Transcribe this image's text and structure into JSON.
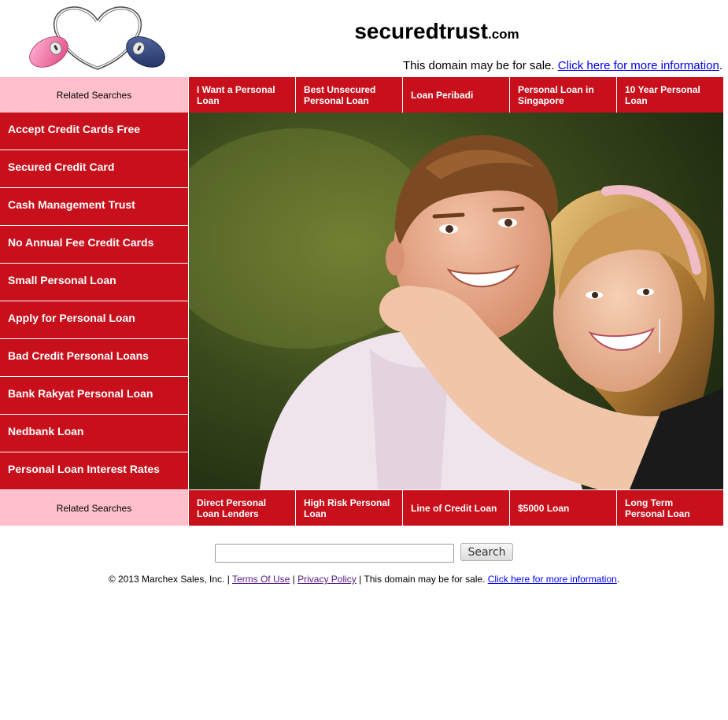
{
  "header": {
    "site_name": "securedtrust",
    "site_tld": ".com",
    "sale_text": "This domain may be for sale. ",
    "sale_link": "Click here for more information",
    "sale_end": "."
  },
  "top_bar": {
    "label": "Related Searches",
    "links": [
      "I Want a Personal Loan",
      "Best Unsecured Personal Loan",
      "Loan Peribadi",
      "Personal Loan in Singapore",
      "10 Year Personal Loan"
    ]
  },
  "sidebar": {
    "items": [
      "Accept Credit Cards Free",
      "Secured Credit Card",
      "Cash Management Trust",
      "No Annual Fee Credit Cards",
      "Small Personal Loan",
      "Apply for Personal Loan",
      "Bad Credit Personal Loans",
      "Bank Rakyat Personal Loan",
      "Nedbank Loan",
      "Personal Loan Interest Rates"
    ]
  },
  "bottom_bar": {
    "label": "Related Searches",
    "links": [
      "Direct Personal Loan Lenders",
      "High Risk Personal Loan",
      "Line of Credit Loan",
      "$5000 Loan",
      "Long Term Personal Loan"
    ]
  },
  "search": {
    "value": "",
    "button_label": "Search"
  },
  "footer": {
    "copyright": "© 2013 Marchex Sales, Inc. | ",
    "terms": "Terms Of Use",
    "sep1": " | ",
    "privacy": "Privacy Policy",
    "sep2": " | This domain may be for sale. ",
    "info_link": "Click here for more information",
    "end": "."
  },
  "colors": {
    "accent_red": "#c8101c",
    "label_pink": "#ffc0cb",
    "link_blue": "#0000ee",
    "visited_purple": "#551a8b"
  },
  "icons": {
    "logo": "heart-mouse-logo-icon"
  }
}
